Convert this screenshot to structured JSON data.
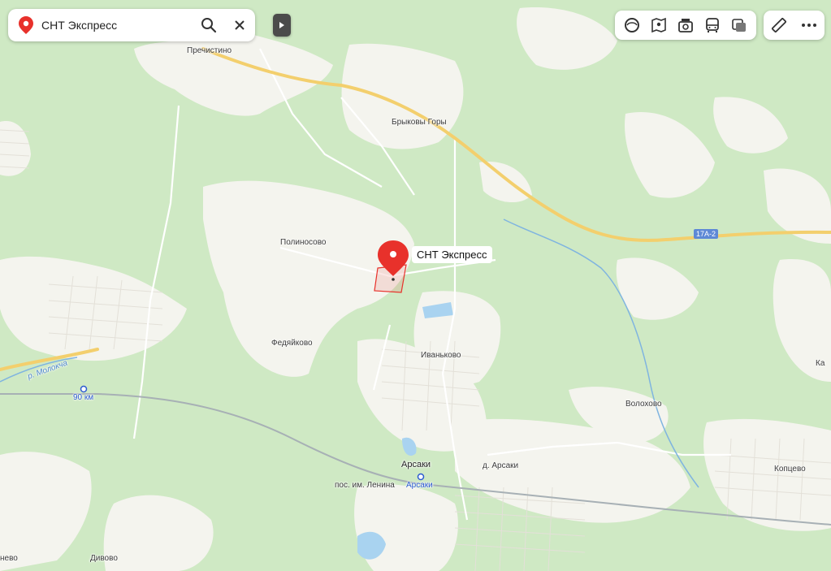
{
  "search": {
    "value": "СНТ Экспресс"
  },
  "toolbar": {
    "items": [
      "layers-icon",
      "transport-map-icon",
      "panorama-icon",
      "transit-icon",
      "map-layers-icon"
    ],
    "extra": [
      "ruler-icon",
      "more-icon"
    ]
  },
  "map": {
    "selected_place": "СНТ Экспресс",
    "road_number": "17А-2",
    "places": {
      "prechistino": "Пречистино",
      "brykovy_gory": "Брыковы Горы",
      "polinosovo": "Полиносово",
      "fedyaikovo": "Федяйково",
      "ivankovo": "Иваньково",
      "volokhovo": "Волохово",
      "arsaki": "Арсаки",
      "d_arsaki": "д. Арсаки",
      "kopcevo": "Копцево",
      "pos_lenina": "пос. им. Ленина",
      "divovo": "Дивово",
      "edge_left": "нево",
      "edge_right": "Ка"
    },
    "stations": {
      "km90": "90 км",
      "arsaki_station": "Арсаки"
    },
    "river": "р. Молокча"
  },
  "colors": {
    "forest": "#cfe9c4",
    "open_land": "#f3f3ee",
    "road_major": "#f6d680",
    "marker": "#e8312b",
    "rail": "#9aa3a8"
  }
}
